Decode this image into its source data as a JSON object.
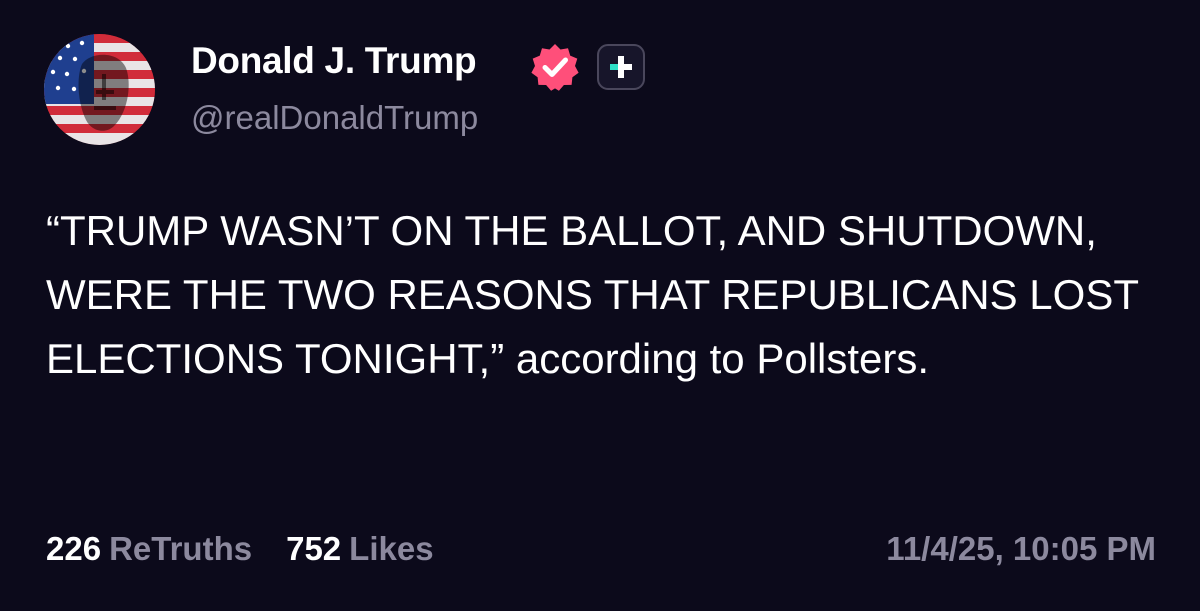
{
  "author": {
    "display_name": "Donald J. Trump",
    "handle": "@realDonaldTrump",
    "avatar_icon": "flag-portrait-avatar",
    "verified_icon": "verified-badge-icon",
    "verified_color": "#ff4f7a",
    "plus_icon": "plus-badge-icon",
    "plus_accent": "#2fe0c8"
  },
  "post": {
    "text": "“TRUMP WASN’T ON THE BALLOT, AND SHUTDOWN, WERE THE TWO REASONS THAT REPUBLICANS LOST ELECTIONS TONIGHT,” according to Pollsters."
  },
  "stats": {
    "retruths_count": "226",
    "retruths_label": "ReTruths",
    "likes_count": "752",
    "likes_label": "Likes"
  },
  "timestamp": "11/4/25, 10:05 PM",
  "colors": {
    "background": "#0c0a1b",
    "text_primary": "#ffffff",
    "text_secondary": "#8c899e"
  }
}
